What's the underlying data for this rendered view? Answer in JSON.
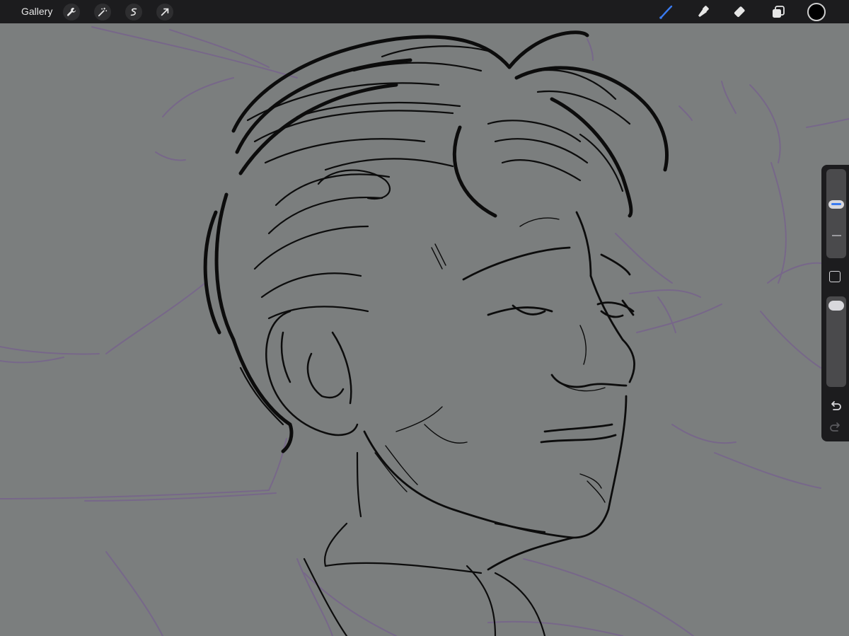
{
  "topbar": {
    "gallery_label": "Gallery",
    "left_tools": [
      "wrench-icon",
      "magic-wand-icon",
      "selection-icon",
      "transform-arrow-icon"
    ],
    "right_tools": [
      "brush-icon",
      "smudge-icon",
      "eraser-icon",
      "layers-icon"
    ],
    "active_tool": "brush",
    "current_color": "#000000"
  },
  "sidebar": {
    "brush_size_level": 0.62,
    "brush_opacity_level": 1.0,
    "buttons": [
      "modify-square-icon",
      "undo-icon",
      "redo-icon"
    ]
  },
  "colors": {
    "accent": "#3a7bf0",
    "canvas": "#7b7e7e",
    "ink": "#0c0c0c",
    "sketch": "#77648c"
  }
}
